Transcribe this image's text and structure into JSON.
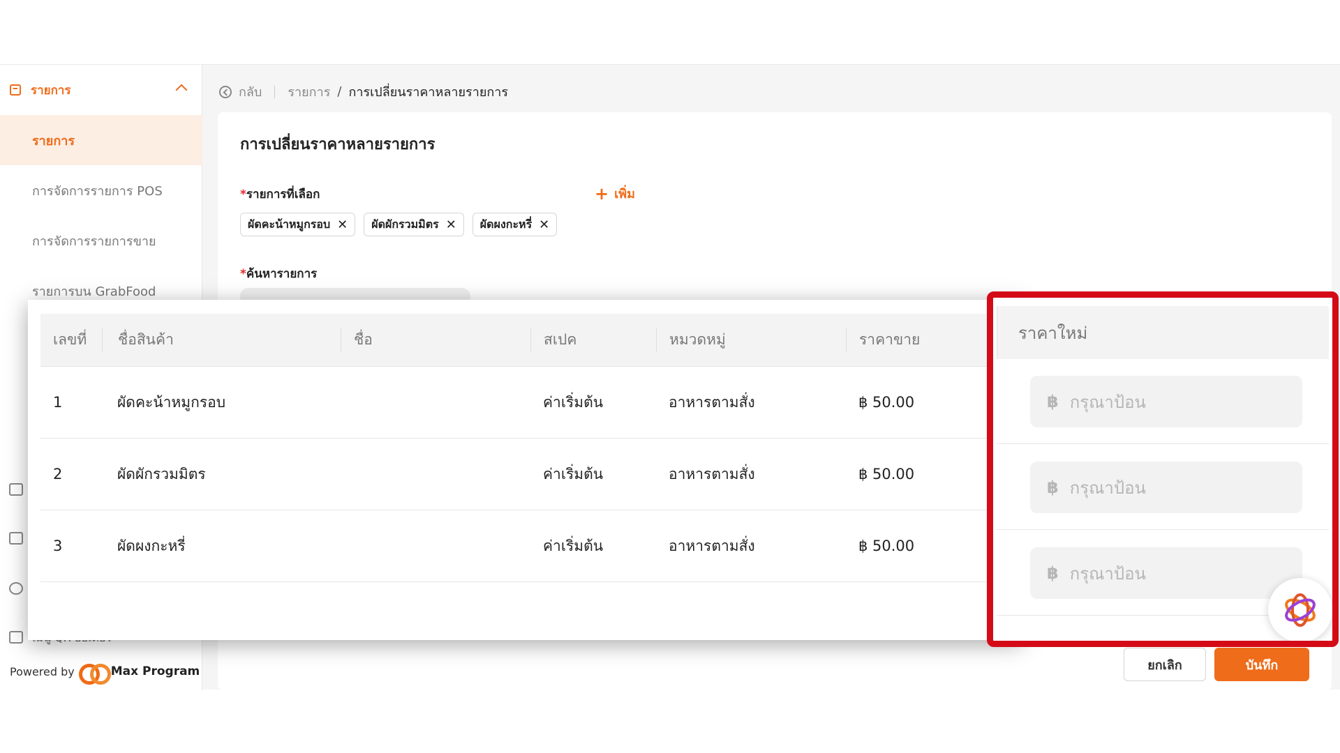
{
  "sidebar": {
    "group_label": "รายการ",
    "items": [
      {
        "label": "รายการ",
        "active": true
      },
      {
        "label": "การจัดการรายการ POS",
        "active": false
      },
      {
        "label": "การจัดการรายการขาย",
        "active": false
      },
      {
        "label": "รายการบน GrabFood",
        "active": false
      }
    ],
    "bottom_item_label": "เมนู QR ออเดอร์",
    "powered_by": "Powered by",
    "brand": "Max Program"
  },
  "breadcrumb": {
    "back_label": "กลับ",
    "parent": "รายการ",
    "separator": "/",
    "current": "การเปลี่ยนราคาหลายรายการ"
  },
  "form": {
    "title": "การเปลี่ยนราคาหลายรายการ",
    "required_mark": "*",
    "selected_label": "รายการที่เลือก",
    "add_label": "เพิ่ม",
    "chips": [
      "ผัดคะน้าหมูกรอบ",
      "ผัดผักรวมมิตร",
      "ผัดผงกะหรี่"
    ],
    "search_label": "ค้นหารายการ"
  },
  "table": {
    "columns": {
      "num": "เลขที่",
      "product": "ชื่อสินค้า",
      "name": "ชื่อ",
      "spec": "สเปค",
      "category": "หมวดหมู่",
      "price": "ราคาขาย",
      "new_price": "ราคาใหม่"
    },
    "rows": [
      {
        "num": "1",
        "product": "ผัดคะน้าหมูกรอบ",
        "name": "",
        "spec": "ค่าเริ่มต้น",
        "category": "อาหารตามสั่ง",
        "price": "฿ 50.00"
      },
      {
        "num": "2",
        "product": "ผัดผักรวมมิตร",
        "name": "",
        "spec": "ค่าเริ่มต้น",
        "category": "อาหารตามสั่ง",
        "price": "฿ 50.00"
      },
      {
        "num": "3",
        "product": "ผัดผงกะหรี่",
        "name": "",
        "spec": "ค่าเริ่มต้น",
        "category": "อาหารตามสั่ง",
        "price": "฿ 50.00"
      }
    ],
    "currency_symbol": "฿",
    "input_placeholder": "กรุณาป้อน"
  },
  "actions": {
    "cancel": "ยกเลิก",
    "save": "บันทึก"
  },
  "colors": {
    "accent": "#ef6c1a",
    "highlight_border": "#d40b17"
  }
}
